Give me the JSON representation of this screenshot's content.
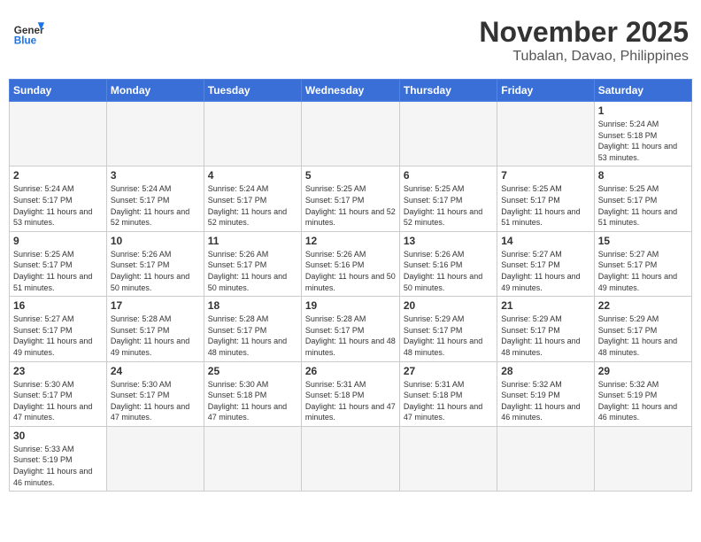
{
  "header": {
    "logo_general": "General",
    "logo_blue": "Blue",
    "month_title": "November 2025",
    "location": "Tubalan, Davao, Philippines"
  },
  "days_of_week": [
    "Sunday",
    "Monday",
    "Tuesday",
    "Wednesday",
    "Thursday",
    "Friday",
    "Saturday"
  ],
  "weeks": [
    [
      {
        "day": "",
        "empty": true
      },
      {
        "day": "",
        "empty": true
      },
      {
        "day": "",
        "empty": true
      },
      {
        "day": "",
        "empty": true
      },
      {
        "day": "",
        "empty": true
      },
      {
        "day": "",
        "empty": true
      },
      {
        "day": "1",
        "sunrise": "Sunrise: 5:24 AM",
        "sunset": "Sunset: 5:18 PM",
        "daylight": "Daylight: 11 hours and 53 minutes."
      }
    ],
    [
      {
        "day": "2",
        "sunrise": "Sunrise: 5:24 AM",
        "sunset": "Sunset: 5:17 PM",
        "daylight": "Daylight: 11 hours and 53 minutes."
      },
      {
        "day": "3",
        "sunrise": "Sunrise: 5:24 AM",
        "sunset": "Sunset: 5:17 PM",
        "daylight": "Daylight: 11 hours and 52 minutes."
      },
      {
        "day": "4",
        "sunrise": "Sunrise: 5:24 AM",
        "sunset": "Sunset: 5:17 PM",
        "daylight": "Daylight: 11 hours and 52 minutes."
      },
      {
        "day": "5",
        "sunrise": "Sunrise: 5:25 AM",
        "sunset": "Sunset: 5:17 PM",
        "daylight": "Daylight: 11 hours and 52 minutes."
      },
      {
        "day": "6",
        "sunrise": "Sunrise: 5:25 AM",
        "sunset": "Sunset: 5:17 PM",
        "daylight": "Daylight: 11 hours and 52 minutes."
      },
      {
        "day": "7",
        "sunrise": "Sunrise: 5:25 AM",
        "sunset": "Sunset: 5:17 PM",
        "daylight": "Daylight: 11 hours and 51 minutes."
      },
      {
        "day": "8",
        "sunrise": "Sunrise: 5:25 AM",
        "sunset": "Sunset: 5:17 PM",
        "daylight": "Daylight: 11 hours and 51 minutes."
      }
    ],
    [
      {
        "day": "9",
        "sunrise": "Sunrise: 5:25 AM",
        "sunset": "Sunset: 5:17 PM",
        "daylight": "Daylight: 11 hours and 51 minutes."
      },
      {
        "day": "10",
        "sunrise": "Sunrise: 5:26 AM",
        "sunset": "Sunset: 5:17 PM",
        "daylight": "Daylight: 11 hours and 50 minutes."
      },
      {
        "day": "11",
        "sunrise": "Sunrise: 5:26 AM",
        "sunset": "Sunset: 5:17 PM",
        "daylight": "Daylight: 11 hours and 50 minutes."
      },
      {
        "day": "12",
        "sunrise": "Sunrise: 5:26 AM",
        "sunset": "Sunset: 5:16 PM",
        "daylight": "Daylight: 11 hours and 50 minutes."
      },
      {
        "day": "13",
        "sunrise": "Sunrise: 5:26 AM",
        "sunset": "Sunset: 5:16 PM",
        "daylight": "Daylight: 11 hours and 50 minutes."
      },
      {
        "day": "14",
        "sunrise": "Sunrise: 5:27 AM",
        "sunset": "Sunset: 5:17 PM",
        "daylight": "Daylight: 11 hours and 49 minutes."
      },
      {
        "day": "15",
        "sunrise": "Sunrise: 5:27 AM",
        "sunset": "Sunset: 5:17 PM",
        "daylight": "Daylight: 11 hours and 49 minutes."
      }
    ],
    [
      {
        "day": "16",
        "sunrise": "Sunrise: 5:27 AM",
        "sunset": "Sunset: 5:17 PM",
        "daylight": "Daylight: 11 hours and 49 minutes."
      },
      {
        "day": "17",
        "sunrise": "Sunrise: 5:28 AM",
        "sunset": "Sunset: 5:17 PM",
        "daylight": "Daylight: 11 hours and 49 minutes."
      },
      {
        "day": "18",
        "sunrise": "Sunrise: 5:28 AM",
        "sunset": "Sunset: 5:17 PM",
        "daylight": "Daylight: 11 hours and 48 minutes."
      },
      {
        "day": "19",
        "sunrise": "Sunrise: 5:28 AM",
        "sunset": "Sunset: 5:17 PM",
        "daylight": "Daylight: 11 hours and 48 minutes."
      },
      {
        "day": "20",
        "sunrise": "Sunrise: 5:29 AM",
        "sunset": "Sunset: 5:17 PM",
        "daylight": "Daylight: 11 hours and 48 minutes."
      },
      {
        "day": "21",
        "sunrise": "Sunrise: 5:29 AM",
        "sunset": "Sunset: 5:17 PM",
        "daylight": "Daylight: 11 hours and 48 minutes."
      },
      {
        "day": "22",
        "sunrise": "Sunrise: 5:29 AM",
        "sunset": "Sunset: 5:17 PM",
        "daylight": "Daylight: 11 hours and 48 minutes."
      }
    ],
    [
      {
        "day": "23",
        "sunrise": "Sunrise: 5:30 AM",
        "sunset": "Sunset: 5:17 PM",
        "daylight": "Daylight: 11 hours and 47 minutes."
      },
      {
        "day": "24",
        "sunrise": "Sunrise: 5:30 AM",
        "sunset": "Sunset: 5:17 PM",
        "daylight": "Daylight: 11 hours and 47 minutes."
      },
      {
        "day": "25",
        "sunrise": "Sunrise: 5:30 AM",
        "sunset": "Sunset: 5:18 PM",
        "daylight": "Daylight: 11 hours and 47 minutes."
      },
      {
        "day": "26",
        "sunrise": "Sunrise: 5:31 AM",
        "sunset": "Sunset: 5:18 PM",
        "daylight": "Daylight: 11 hours and 47 minutes."
      },
      {
        "day": "27",
        "sunrise": "Sunrise: 5:31 AM",
        "sunset": "Sunset: 5:18 PM",
        "daylight": "Daylight: 11 hours and 47 minutes."
      },
      {
        "day": "28",
        "sunrise": "Sunrise: 5:32 AM",
        "sunset": "Sunset: 5:19 PM",
        "daylight": "Daylight: 11 hours and 46 minutes."
      },
      {
        "day": "29",
        "sunrise": "Sunrise: 5:32 AM",
        "sunset": "Sunset: 5:19 PM",
        "daylight": "Daylight: 11 hours and 46 minutes."
      }
    ],
    [
      {
        "day": "30",
        "sunrise": "Sunrise: 5:33 AM",
        "sunset": "Sunset: 5:19 PM",
        "daylight": "Daylight: 11 hours and 46 minutes."
      },
      {
        "day": "",
        "empty": true
      },
      {
        "day": "",
        "empty": true
      },
      {
        "day": "",
        "empty": true
      },
      {
        "day": "",
        "empty": true
      },
      {
        "day": "",
        "empty": true
      },
      {
        "day": "",
        "empty": true
      }
    ]
  ]
}
